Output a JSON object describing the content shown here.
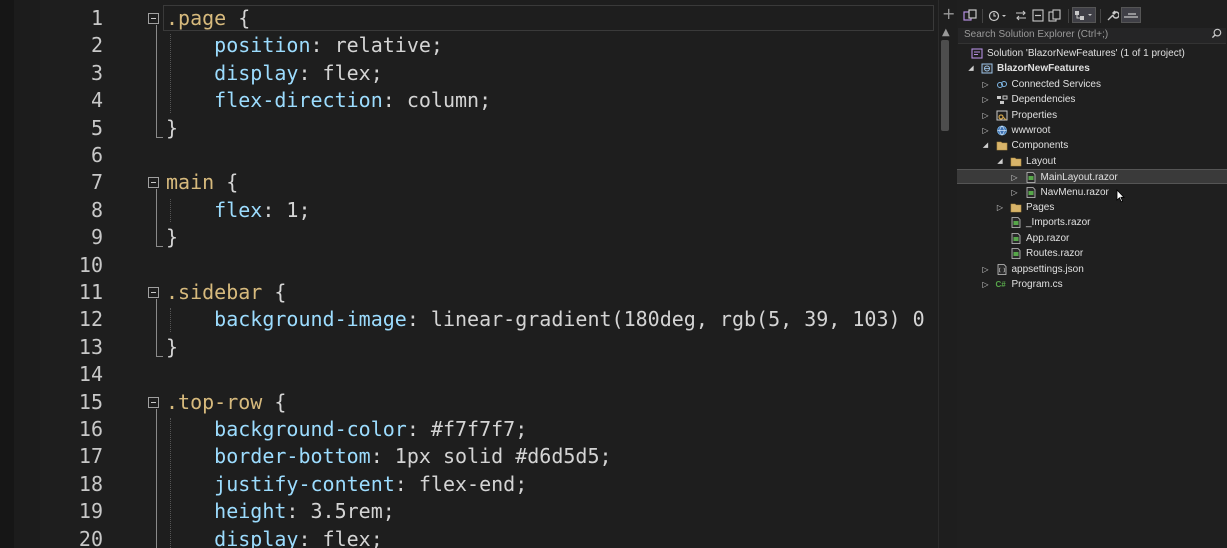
{
  "editor": {
    "lines": [
      {
        "n": "1",
        "t": [
          {
            "c": "sel",
            "v": ".page"
          },
          {
            "c": "punc",
            "v": " {"
          }
        ]
      },
      {
        "n": "2",
        "t": [
          {
            "c": "prop",
            "v": "    position"
          },
          {
            "c": "punc",
            "v": ": "
          },
          {
            "c": "val",
            "v": "relative"
          },
          {
            "c": "punc",
            "v": ";"
          }
        ]
      },
      {
        "n": "3",
        "t": [
          {
            "c": "prop",
            "v": "    display"
          },
          {
            "c": "punc",
            "v": ": "
          },
          {
            "c": "val",
            "v": "flex"
          },
          {
            "c": "punc",
            "v": ";"
          }
        ]
      },
      {
        "n": "4",
        "t": [
          {
            "c": "prop",
            "v": "    flex-direction"
          },
          {
            "c": "punc",
            "v": ": "
          },
          {
            "c": "val",
            "v": "column"
          },
          {
            "c": "punc",
            "v": ";"
          }
        ]
      },
      {
        "n": "5",
        "t": [
          {
            "c": "punc",
            "v": "}"
          }
        ]
      },
      {
        "n": "6",
        "t": []
      },
      {
        "n": "7",
        "t": [
          {
            "c": "sel",
            "v": "main"
          },
          {
            "c": "punc",
            "v": " {"
          }
        ]
      },
      {
        "n": "8",
        "t": [
          {
            "c": "prop",
            "v": "    flex"
          },
          {
            "c": "punc",
            "v": ": "
          },
          {
            "c": "val",
            "v": "1"
          },
          {
            "c": "punc",
            "v": ";"
          }
        ]
      },
      {
        "n": "9",
        "t": [
          {
            "c": "punc",
            "v": "}"
          }
        ]
      },
      {
        "n": "10",
        "t": []
      },
      {
        "n": "11",
        "t": [
          {
            "c": "sel",
            "v": ".sidebar"
          },
          {
            "c": "punc",
            "v": " {"
          }
        ]
      },
      {
        "n": "12",
        "t": [
          {
            "c": "prop",
            "v": "    background-image"
          },
          {
            "c": "punc",
            "v": ": "
          },
          {
            "c": "val",
            "v": "linear-gradient(180deg, rgb(5, 39, 103) 0"
          }
        ]
      },
      {
        "n": "13",
        "t": [
          {
            "c": "punc",
            "v": "}"
          }
        ]
      },
      {
        "n": "14",
        "t": []
      },
      {
        "n": "15",
        "t": [
          {
            "c": "sel",
            "v": ".top-row"
          },
          {
            "c": "punc",
            "v": " {"
          }
        ]
      },
      {
        "n": "16",
        "t": [
          {
            "c": "prop",
            "v": "    background-color"
          },
          {
            "c": "punc",
            "v": ": "
          },
          {
            "c": "val",
            "v": "#f7f7f7"
          },
          {
            "c": "punc",
            "v": ";"
          }
        ]
      },
      {
        "n": "17",
        "t": [
          {
            "c": "prop",
            "v": "    border-bottom"
          },
          {
            "c": "punc",
            "v": ": "
          },
          {
            "c": "val",
            "v": "1px solid #d6d5d5"
          },
          {
            "c": "punc",
            "v": ";"
          }
        ]
      },
      {
        "n": "18",
        "t": [
          {
            "c": "prop",
            "v": "    justify-content"
          },
          {
            "c": "punc",
            "v": ": "
          },
          {
            "c": "val",
            "v": "flex-end"
          },
          {
            "c": "punc",
            "v": ";"
          }
        ]
      },
      {
        "n": "19",
        "t": [
          {
            "c": "prop",
            "v": "    height"
          },
          {
            "c": "punc",
            "v": ": "
          },
          {
            "c": "val",
            "v": "3.5rem"
          },
          {
            "c": "punc",
            "v": ";"
          }
        ]
      },
      {
        "n": "20",
        "t": [
          {
            "c": "prop",
            "v": "    display"
          },
          {
            "c": "punc",
            "v": ": "
          },
          {
            "c": "val",
            "v": "flex"
          },
          {
            "c": "punc",
            "v": ";"
          }
        ]
      }
    ],
    "colors": {
      "selector": "#d7ba7d",
      "property": "#9cdcfe",
      "value": "#d4d4d4",
      "line_number": "#c8c8c8",
      "background": "#1e1e1e"
    }
  },
  "solution_explorer": {
    "search_placeholder": "Search Solution Explorer (Ctrl+;)",
    "items": [
      {
        "label": "Solution 'BlazorNewFeatures' (1 of 1 project)",
        "icon": "solution-icon",
        "arrow": "",
        "depth": 0
      },
      {
        "label": "BlazorNewFeatures",
        "icon": "project-icon",
        "arrow": "expanded",
        "depth": 0,
        "bold": true
      },
      {
        "label": "Connected Services",
        "icon": "connected-services-icon",
        "arrow": "collapsed",
        "depth": 1
      },
      {
        "label": "Dependencies",
        "icon": "dependencies-icon",
        "arrow": "collapsed",
        "depth": 1
      },
      {
        "label": "Properties",
        "icon": "properties-icon",
        "arrow": "collapsed",
        "depth": 1
      },
      {
        "label": "wwwroot",
        "icon": "globe-icon",
        "arrow": "collapsed",
        "depth": 1
      },
      {
        "label": "Components",
        "icon": "folder-icon",
        "arrow": "expanded",
        "depth": 1
      },
      {
        "label": "Layout",
        "icon": "folder-icon",
        "arrow": "expanded",
        "depth": 2
      },
      {
        "label": "MainLayout.razor",
        "icon": "razor-file-icon",
        "arrow": "collapsed",
        "depth": 3,
        "selected": true
      },
      {
        "label": "NavMenu.razor",
        "icon": "razor-file-icon",
        "arrow": "collapsed",
        "depth": 3
      },
      {
        "label": "Pages",
        "icon": "folder-icon",
        "arrow": "collapsed",
        "depth": 2
      },
      {
        "label": "_Imports.razor",
        "icon": "razor-file-icon",
        "arrow": "",
        "depth": 2
      },
      {
        "label": "App.razor",
        "icon": "razor-file-icon",
        "arrow": "",
        "depth": 2
      },
      {
        "label": "Routes.razor",
        "icon": "razor-file-icon",
        "arrow": "",
        "depth": 2
      },
      {
        "label": "appsettings.json",
        "icon": "json-file-icon",
        "arrow": "collapsed",
        "depth": 1
      },
      {
        "label": "Program.cs",
        "icon": "csharp-file-icon",
        "arrow": "collapsed",
        "depth": 1
      }
    ],
    "csharp_badge": "C#"
  }
}
